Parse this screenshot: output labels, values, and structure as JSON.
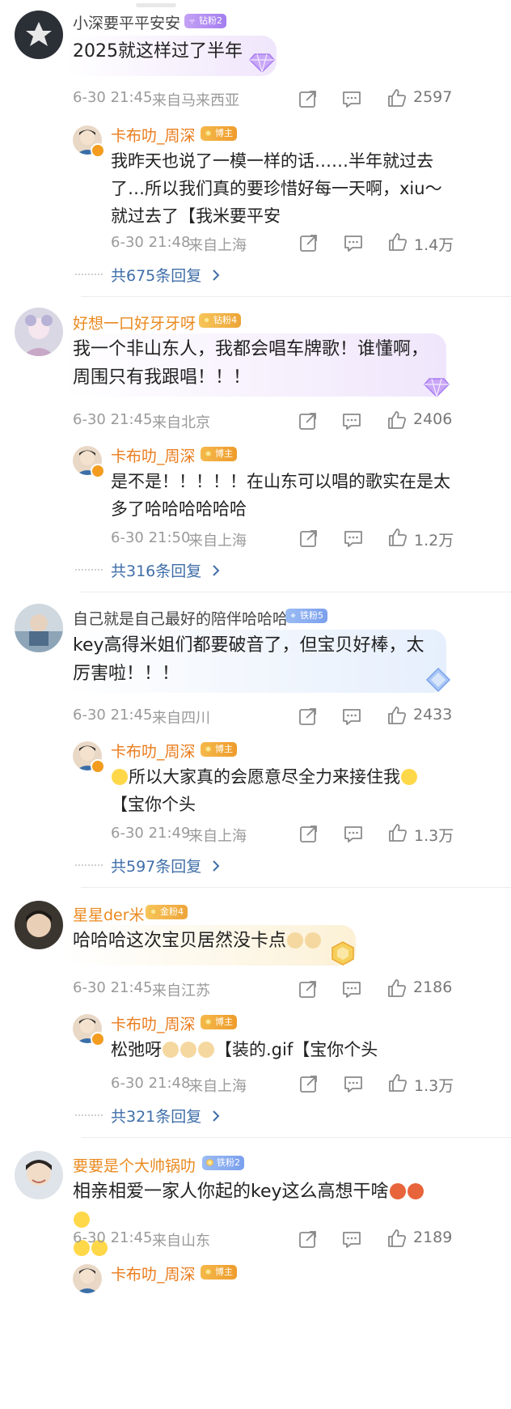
{
  "colors": {
    "author": "#ea7c1c",
    "more_link": "#3f6ea8",
    "meta": "#9a9a9a"
  },
  "comments": [
    {
      "user": "小深要平平安安",
      "badge": "钻粉2",
      "text": "2025就这样过了半年",
      "time": "6-30 21:45",
      "location": "来自马来西亚",
      "likes": "2597",
      "reply": {
        "user": "卡布叻_周深",
        "badge": "博主",
        "text": "我昨天也说了一模一样的话……半年就过去了…所以我们真的要珍惜好每一天啊，xiu～就过去了【我米要平安",
        "time": "6-30 21:48",
        "location": "来自上海",
        "likes": "1.4万"
      },
      "more": "共675条回复"
    },
    {
      "user": "好想一口好牙牙呀",
      "badge": "钻粉4",
      "text": "我一个非山东人，我都会唱车牌歌！谁懂啊，周围只有我跟唱！！！",
      "time": "6-30 21:45",
      "location": "来自北京",
      "likes": "2406",
      "reply": {
        "user": "卡布叻_周深",
        "badge": "博主",
        "text": "是不是！！！！！在山东可以唱的歌实在是太多了哈哈哈哈哈哈",
        "time": "6-30 21:50",
        "location": "来自上海",
        "likes": "1.2万"
      },
      "more": "共316条回复"
    },
    {
      "user": "自己就是自己最好的陪伴哈哈哈",
      "badge": "铁粉5",
      "text": "key高得米姐们都要破音了，但宝贝好棒，太厉害啦！！！",
      "time": "6-30 21:45",
      "location": "来自四川",
      "likes": "2433",
      "reply": {
        "user": "卡布叻_周深",
        "badge": "博主",
        "text_a": "所以大家真的会愿意尽全力来接住我",
        "text_b": "【宝你个头",
        "time": "6-30 21:49",
        "location": "来自上海",
        "likes": "1.3万"
      },
      "more": "共597条回复"
    },
    {
      "user": "星星der米",
      "badge": "金粉4",
      "text": "哈哈哈这次宝贝居然没卡点",
      "time": "6-30 21:45",
      "location": "来自江苏",
      "likes": "2186",
      "reply": {
        "user": "卡布叻_周深",
        "badge": "博主",
        "text_a": "松弛呀",
        "text_b": "【装的.gif【宝你个头",
        "time": "6-30 21:48",
        "location": "来自上海",
        "likes": "1.3万"
      },
      "more": "共321条回复"
    },
    {
      "user": "要要是个大帅锅叻",
      "badge": "铁粉2",
      "text": "相亲相爱一家人你起的key这么高想干啥",
      "time": "6-30 21:45",
      "location": "来自山东",
      "likes": "2189",
      "reply": {
        "user": "卡布叻_周深",
        "badge": "博主"
      }
    }
  ],
  "icons": {
    "share": "share-icon",
    "comment": "comment-icon",
    "like": "thumbs-up-icon",
    "chevron": "chevron-right-icon"
  }
}
